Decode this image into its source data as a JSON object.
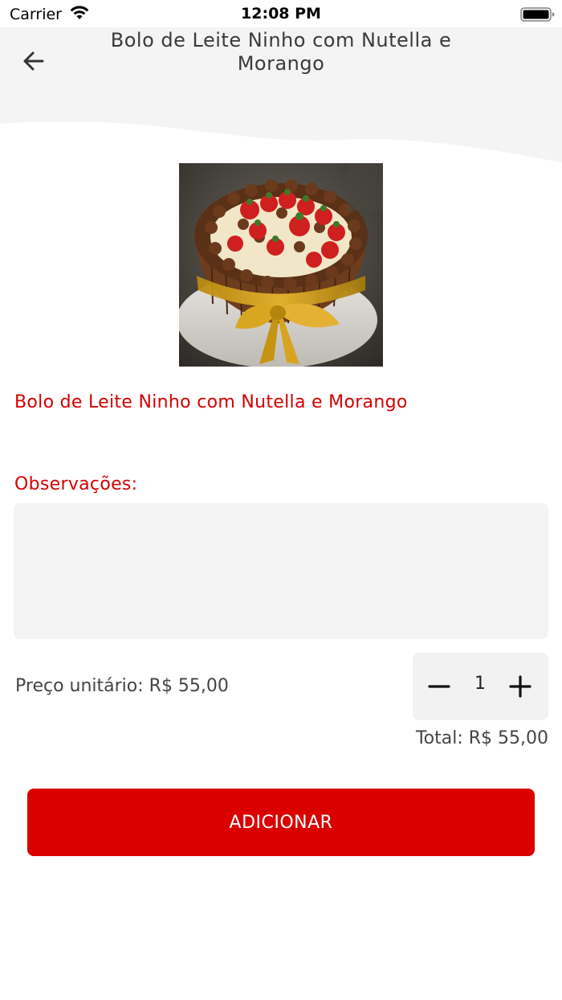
{
  "status_bar": {
    "carrier": "Carrier",
    "time": "12:08 PM"
  },
  "header": {
    "title": "Bolo de Leite Ninho com Nutella e Morango",
    "back_icon": "arrow-left-icon"
  },
  "product": {
    "image_icon": "cake-photo",
    "name": "Bolo de Leite Ninho com Nutella e Morango"
  },
  "observations": {
    "label": "Observações:",
    "value": "",
    "placeholder": ""
  },
  "pricing": {
    "unit_price_label": "Preço unitário: R$ 55,00",
    "quantity": "1",
    "total_label": "Total: R$ 55,00"
  },
  "actions": {
    "add_label": "ADICIONAR"
  },
  "colors": {
    "accent": "#da0000",
    "text_accent": "#d40000",
    "field_bg": "#f3f3f3"
  }
}
